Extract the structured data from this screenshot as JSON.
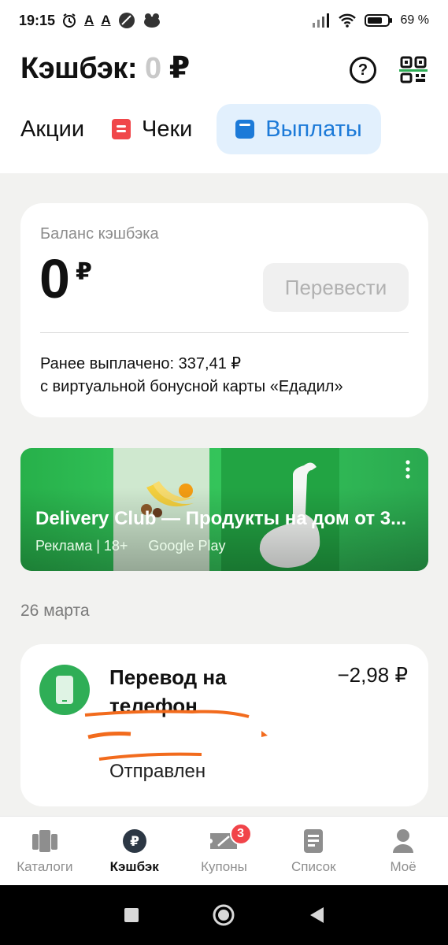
{
  "status_bar": {
    "time": "19:15",
    "a1": "A",
    "a2": "A",
    "battery": "69 %"
  },
  "header": {
    "title_prefix": "Кэшбэк:",
    "title_value": "0",
    "title_currency": "₽"
  },
  "tabs": {
    "promo": "Акции",
    "checks": "Чеки",
    "payouts": "Выплаты"
  },
  "balance": {
    "label": "Баланс кэшбэка",
    "value": "0",
    "currency": "₽",
    "transfer_button": "Перевести",
    "paid_line1": "Ранее выплачено: 337,41 ₽",
    "paid_line2": "с виртуальной бонусной карты «Едадил»"
  },
  "ad": {
    "title": "Delivery Club — Продукты на дом от 3...",
    "label": "Реклама | 18+",
    "source": "Google Play"
  },
  "feed": {
    "date": "26 марта",
    "transaction": {
      "title": "Перевод на телефон",
      "amount": "−2,98 ₽",
      "status": "Отправлен"
    }
  },
  "tabbar": {
    "items": [
      {
        "label": "Каталоги",
        "icon": "catalogs-icon"
      },
      {
        "label": "Кэшбэк",
        "icon": "cashback-icon",
        "active": true
      },
      {
        "label": "Купоны",
        "icon": "coupons-icon",
        "badge": "3"
      },
      {
        "label": "Список",
        "icon": "list-icon"
      },
      {
        "label": "Моё",
        "icon": "profile-icon"
      }
    ]
  },
  "colors": {
    "accent": "#1c7ad8",
    "accent_bg": "#e2f0fd",
    "checks_red": "#f0474a",
    "green": "#2fae56",
    "badge": "#f1444a"
  }
}
